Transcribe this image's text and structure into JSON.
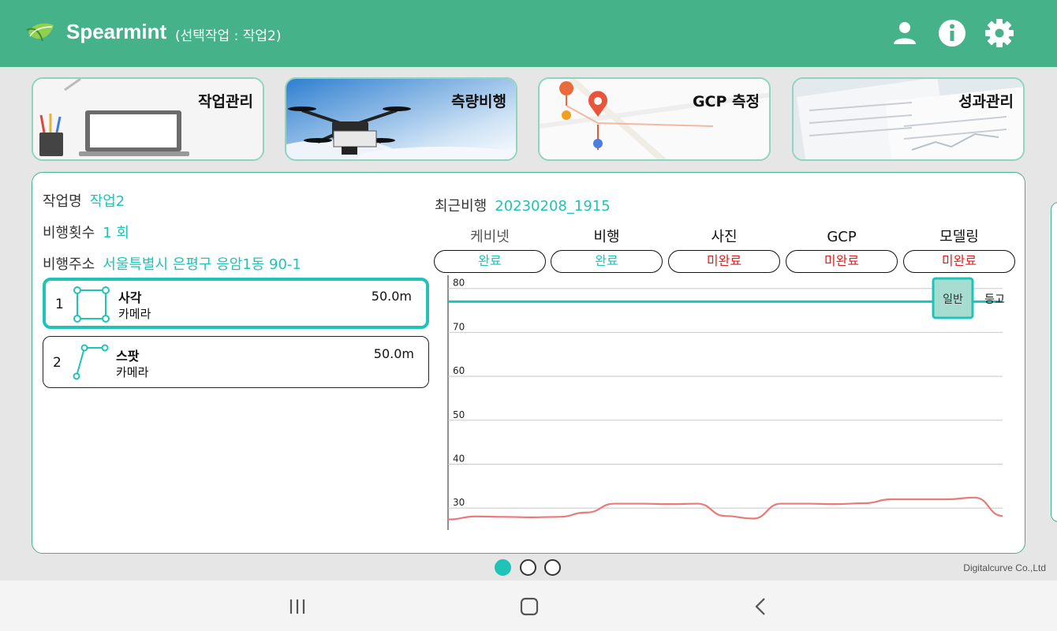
{
  "header": {
    "app_name": "Spearmint",
    "subtitle": "(선택작업 : 작업2)",
    "icons": [
      "person-icon",
      "info-icon",
      "gear-icon"
    ]
  },
  "tiles": [
    {
      "label": "작업관리"
    },
    {
      "label": "측량비행"
    },
    {
      "label": "GCP 측정"
    },
    {
      "label": "성과관리"
    }
  ],
  "job": {
    "name_label": "작업명",
    "name_value": "작업2",
    "count_label": "비행횟수",
    "count_value": "1 회",
    "address_label": "비행주소",
    "address_value": "서울특별시 은평구 응암1동 90-1"
  },
  "routes": [
    {
      "num": "1",
      "type": "사각",
      "sensor": "카메라",
      "altitude": "50.0m",
      "icon": "rectangle-route-icon"
    },
    {
      "num": "2",
      "type": "스팟",
      "sensor": "카메라",
      "altitude": "50.0m",
      "icon": "spot-route-icon"
    }
  ],
  "recent": {
    "label": "최근비행",
    "value": "20230208_1915"
  },
  "steps": [
    {
      "label": "케비넷",
      "status": "완료",
      "done": true
    },
    {
      "label": "비행",
      "status": "완료",
      "done": true
    },
    {
      "label": "사진",
      "status": "미완료",
      "done": false
    },
    {
      "label": "GCP",
      "status": "미완료",
      "done": false
    },
    {
      "label": "모델링",
      "status": "미완료",
      "done": false
    }
  ],
  "chart_data": {
    "type": "line",
    "y_ticks": [
      30,
      40,
      50,
      60,
      70,
      80
    ],
    "ylim": [
      25,
      83
    ],
    "toggle": {
      "selected": "일반",
      "other": "등고"
    },
    "reference_line": 77,
    "series": [
      {
        "color": "#e87a7a",
        "values": [
          27.4,
          28.1,
          28.0,
          27.9,
          28.0,
          29.0,
          31.0,
          31.0,
          30.9,
          31.0,
          28.2,
          27.6,
          31.0,
          31.0,
          30.9,
          31.1,
          32.0,
          32.0,
          32.0,
          32.4,
          28.2
        ]
      }
    ],
    "colors": {
      "reference": "#1fc3b8",
      "grid": "#c8c8c8"
    }
  },
  "pager": {
    "pages": 3,
    "active": 0
  },
  "footer": {
    "company": "Digitalcurve Co.,Ltd"
  }
}
